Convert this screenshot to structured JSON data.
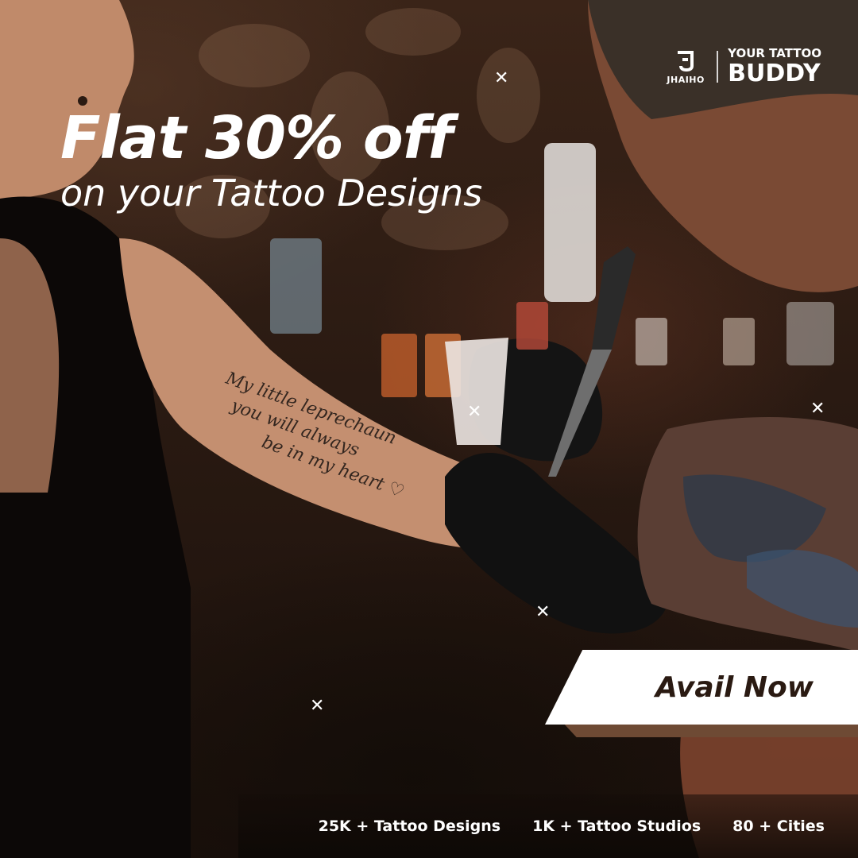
{
  "brand": {
    "logo_name": "JHAIHO",
    "tagline_top": "YOUR TATTOO",
    "tagline_bottom": "BUDDY"
  },
  "headline": {
    "main": "Flat 30% off",
    "sub": "on your Tattoo Designs"
  },
  "tattoo_script": {
    "lines": [
      "My little leprechaun",
      "you will always",
      "be in my heart ♡"
    ]
  },
  "cta": {
    "label": "Avail Now"
  },
  "stats": [
    "25K + Tattoo Designs",
    "1K + Tattoo Studios",
    "80 + Cities"
  ],
  "colors": {
    "background": "#2a1a12",
    "text": "#ffffff",
    "cta_text": "#2a1a12",
    "cta_accent": "#6e4a34"
  }
}
